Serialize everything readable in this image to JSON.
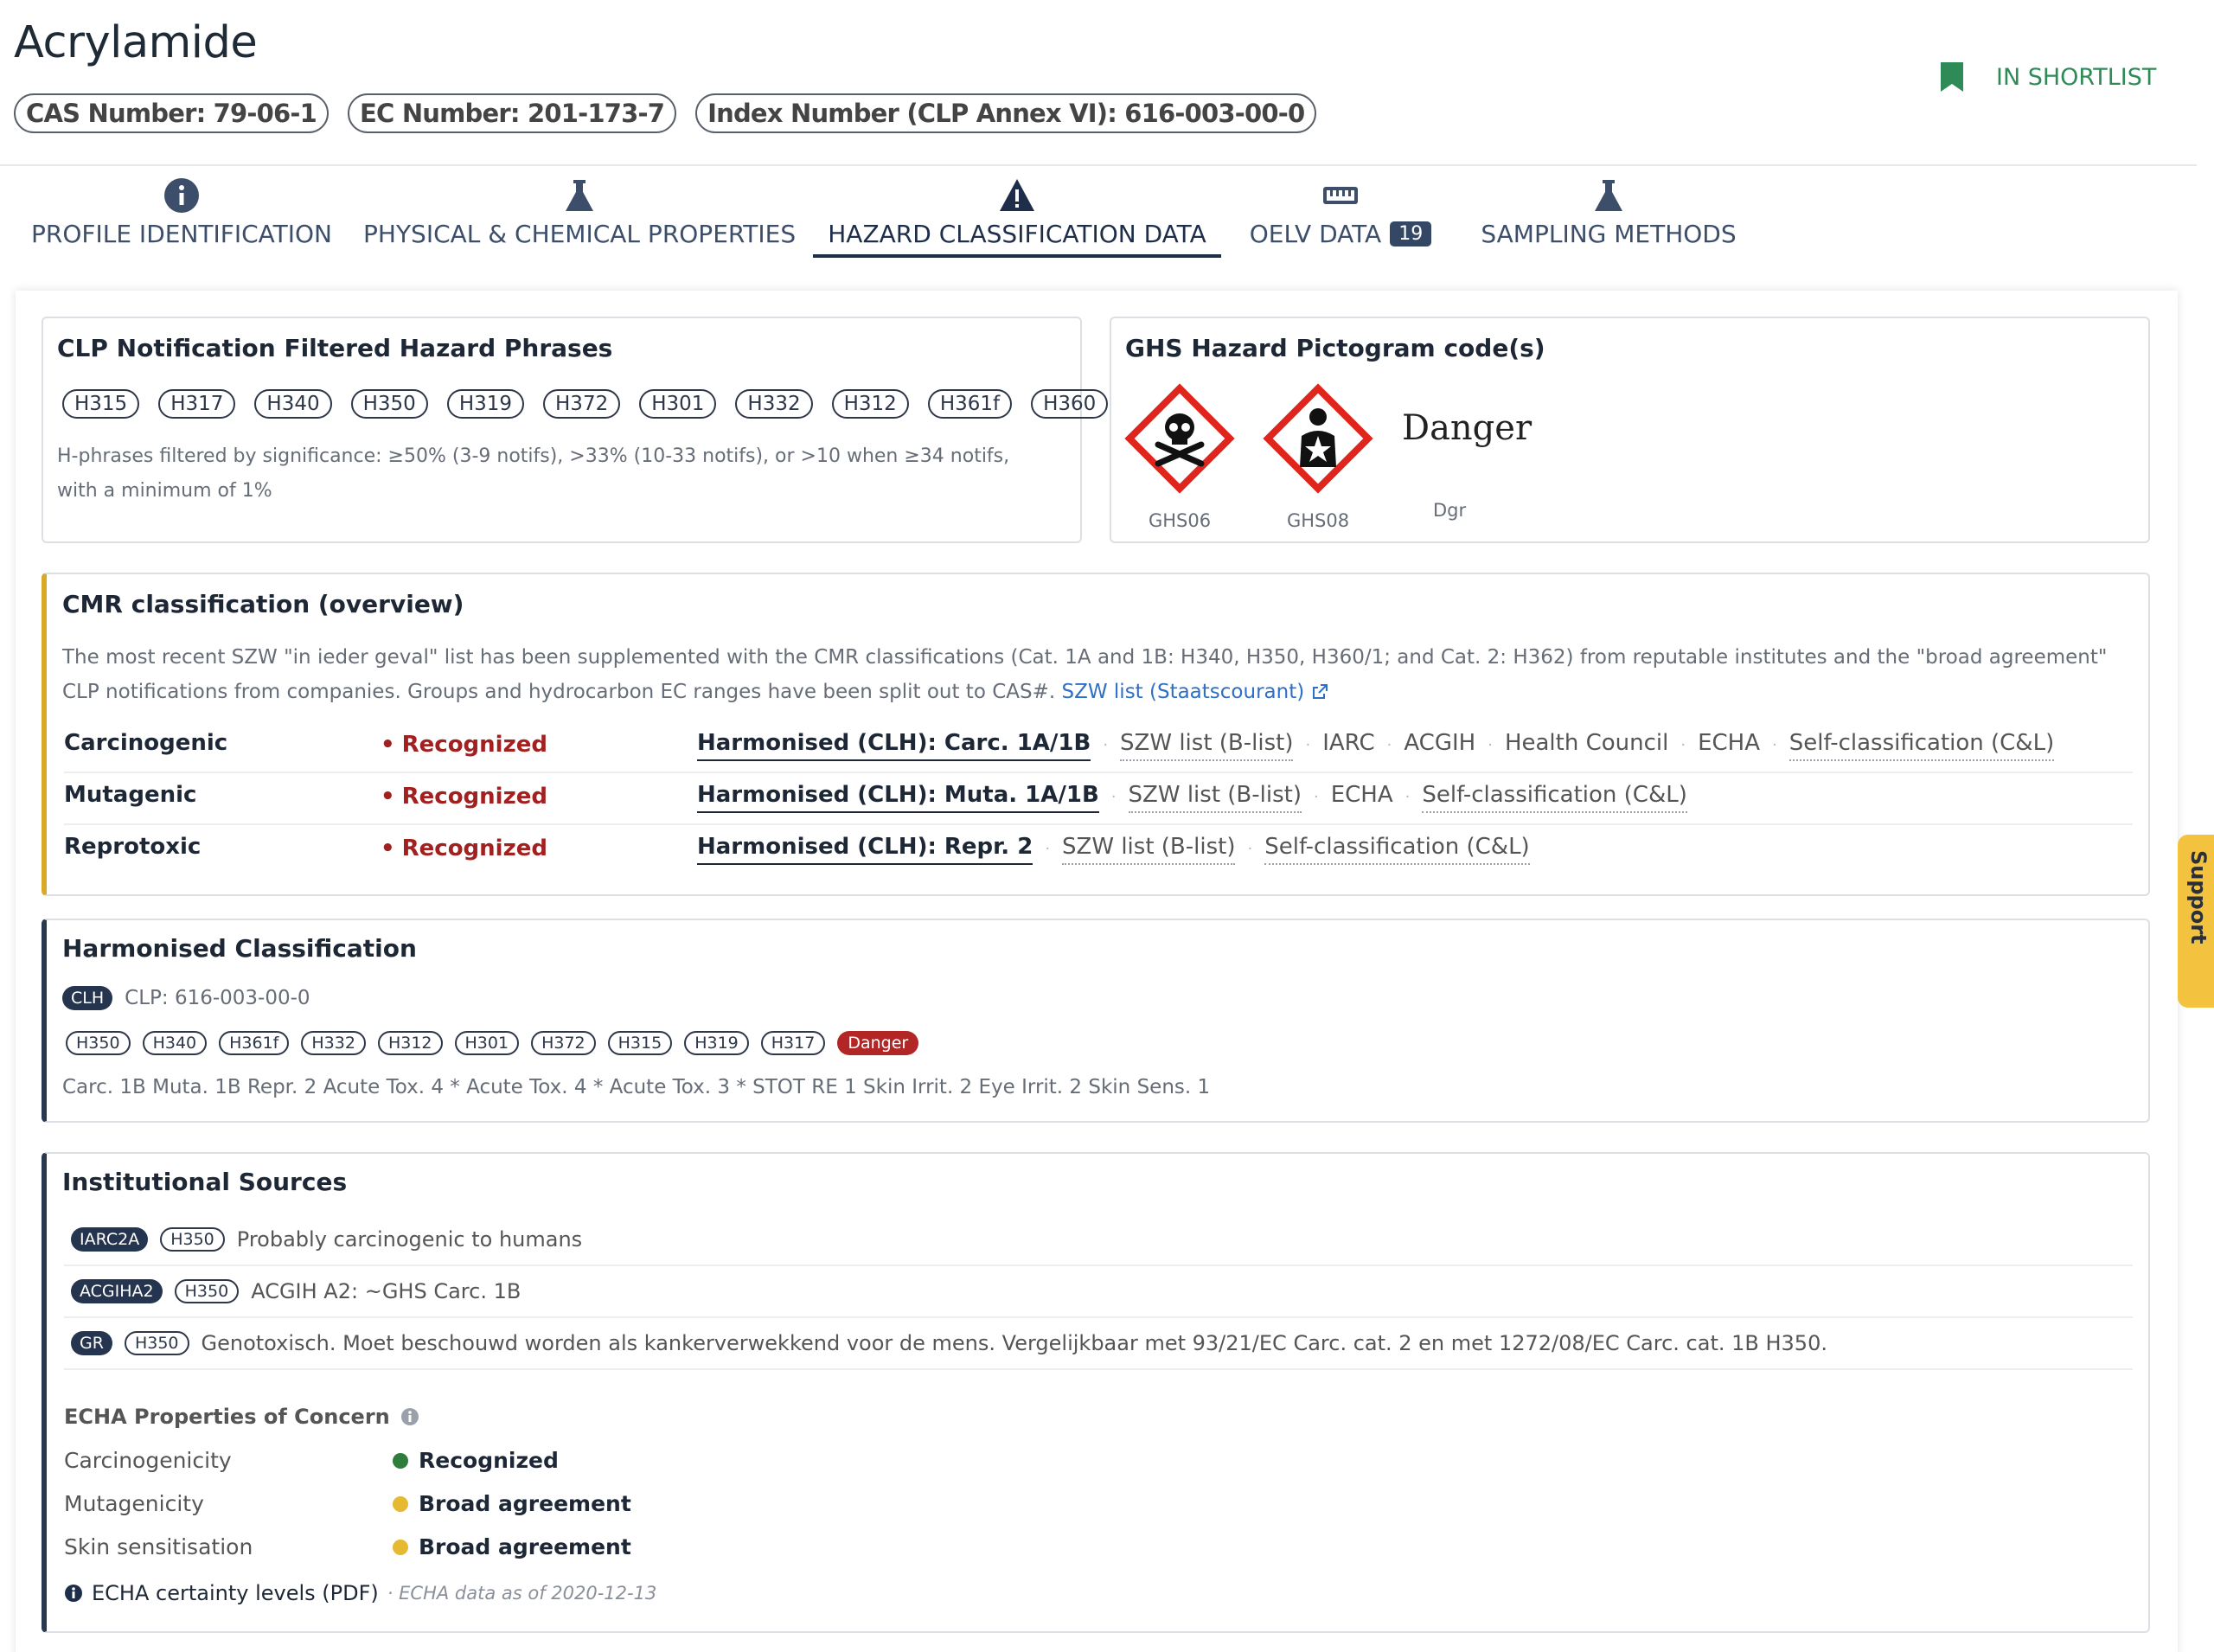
{
  "substance": {
    "name": "Acrylamide",
    "identifiers": [
      "CAS Number: 79-06-1",
      "EC Number: 201-173-7",
      "Index Number (CLP Annex VI): 616-003-00-0"
    ]
  },
  "shortlist": {
    "label": "IN SHORTLIST",
    "icon": "bookmark-icon",
    "color": "#2e8b57"
  },
  "tabs": [
    {
      "label": "PROFILE IDENTIFICATION",
      "icon": "info-icon"
    },
    {
      "label": "PHYSICAL & CHEMICAL PROPERTIES",
      "icon": "flask-icon"
    },
    {
      "label": "HAZARD CLASSIFICATION DATA",
      "icon": "warning-icon",
      "active": true
    },
    {
      "label": "OELV DATA",
      "icon": "ruler-icon",
      "count": "19"
    },
    {
      "label": "SAMPLING METHODS",
      "icon": "flask-icon"
    }
  ],
  "clp": {
    "title": "CLP Notification Filtered Hazard Phrases",
    "phrases": [
      "H315",
      "H317",
      "H340",
      "H350",
      "H319",
      "H372",
      "H301",
      "H332",
      "H312",
      "H361f",
      "H360"
    ],
    "note_line1": "H-phrases filtered by significance: ≥50% (3-9 notifs), >33% (10-33 notifs), or >10 when ≥34 notifs,",
    "note_line2": "with a minimum of 1%"
  },
  "ghs": {
    "title": "GHS Hazard Pictogram code(s)",
    "pictograms": [
      {
        "code": "GHS06",
        "icon": "skull-crossbones-icon"
      },
      {
        "code": "GHS08",
        "icon": "health-hazard-icon"
      }
    ],
    "signal_word": "Danger",
    "signal_code": "Dgr"
  },
  "cmr": {
    "title": "CMR classification (overview)",
    "desc_line1": "The most recent SZW \"in ieder geval\" list has been supplemented with the CMR classifications (Cat. 1A and 1B: H340, H350, H360/1; and Cat. 2: H362) from reputable institutes and the \"broad agreement\"",
    "desc_line2": "CLP notifications from companies. Groups and hydrocarbon EC ranges have been split out to CAS#.",
    "link": "SZW list (Staatscourant)",
    "rows": [
      {
        "name": "Carcinogenic",
        "status": "Recognized",
        "sources": [
          "Harmonised (CLH): Carc. 1A/1B",
          "SZW list (B-list)",
          "IARC",
          "ACGIH",
          "Health Council",
          "ECHA",
          "Self-classification (C&L)"
        ]
      },
      {
        "name": "Mutagenic",
        "status": "Recognized",
        "sources": [
          "Harmonised (CLH): Muta. 1A/1B",
          "SZW list (B-list)",
          "ECHA",
          "Self-classification (C&L)"
        ]
      },
      {
        "name": "Reprotoxic",
        "status": "Recognized",
        "sources": [
          "Harmonised (CLH): Repr. 2",
          "SZW list (B-list)",
          "Self-classification (C&L)"
        ]
      }
    ],
    "status_color": "#a32020"
  },
  "harmonised": {
    "title": "Harmonised Classification",
    "badge": "CLH",
    "clp_ref": "CLP: 616-003-00-0",
    "phrases": [
      "H350",
      "H340",
      "H361f",
      "H332",
      "H312",
      "H301",
      "H372",
      "H315",
      "H319",
      "H317"
    ],
    "signal": "Danger",
    "classes": "Carc. 1B Muta. 1B Repr. 2 Acute Tox. 4 * Acute Tox. 4 * Acute Tox. 3 * STOT RE 1 Skin Irrit. 2 Eye Irrit. 2 Skin Sens. 1"
  },
  "institutional": {
    "title": "Institutional Sources",
    "rows": [
      {
        "badge": "IARC2A",
        "phrase": "H350",
        "text": "Probably carcinogenic to humans"
      },
      {
        "badge": "ACGIHA2",
        "phrase": "H350",
        "text": "ACGIH A2: ~GHS Carc. 1B"
      },
      {
        "badge": "GR",
        "phrase": "H350",
        "text": "Genotoxisch. Moet beschouwd worden als kankerverwekkend voor de mens. Vergelijkbaar met 93/21/EC Carc. cat. 2 en met 1272/08/EC Carc. cat. 1B H350."
      }
    ],
    "echa_title": "ECHA Properties of Concern",
    "properties": [
      {
        "name": "Carcinogenicity",
        "level": "Recognized",
        "color": "#2f7d3a"
      },
      {
        "name": "Mutagenicity",
        "level": "Broad agreement",
        "color": "#e6b933"
      },
      {
        "name": "Skin sensitisation",
        "level": "Broad agreement",
        "color": "#e6b933"
      }
    ],
    "certainty_link": "ECHA certainty levels (PDF)",
    "data_date": "· ECHA data as of 2020-12-13"
  },
  "support": {
    "label": "Support",
    "icon": "headset-icon"
  }
}
